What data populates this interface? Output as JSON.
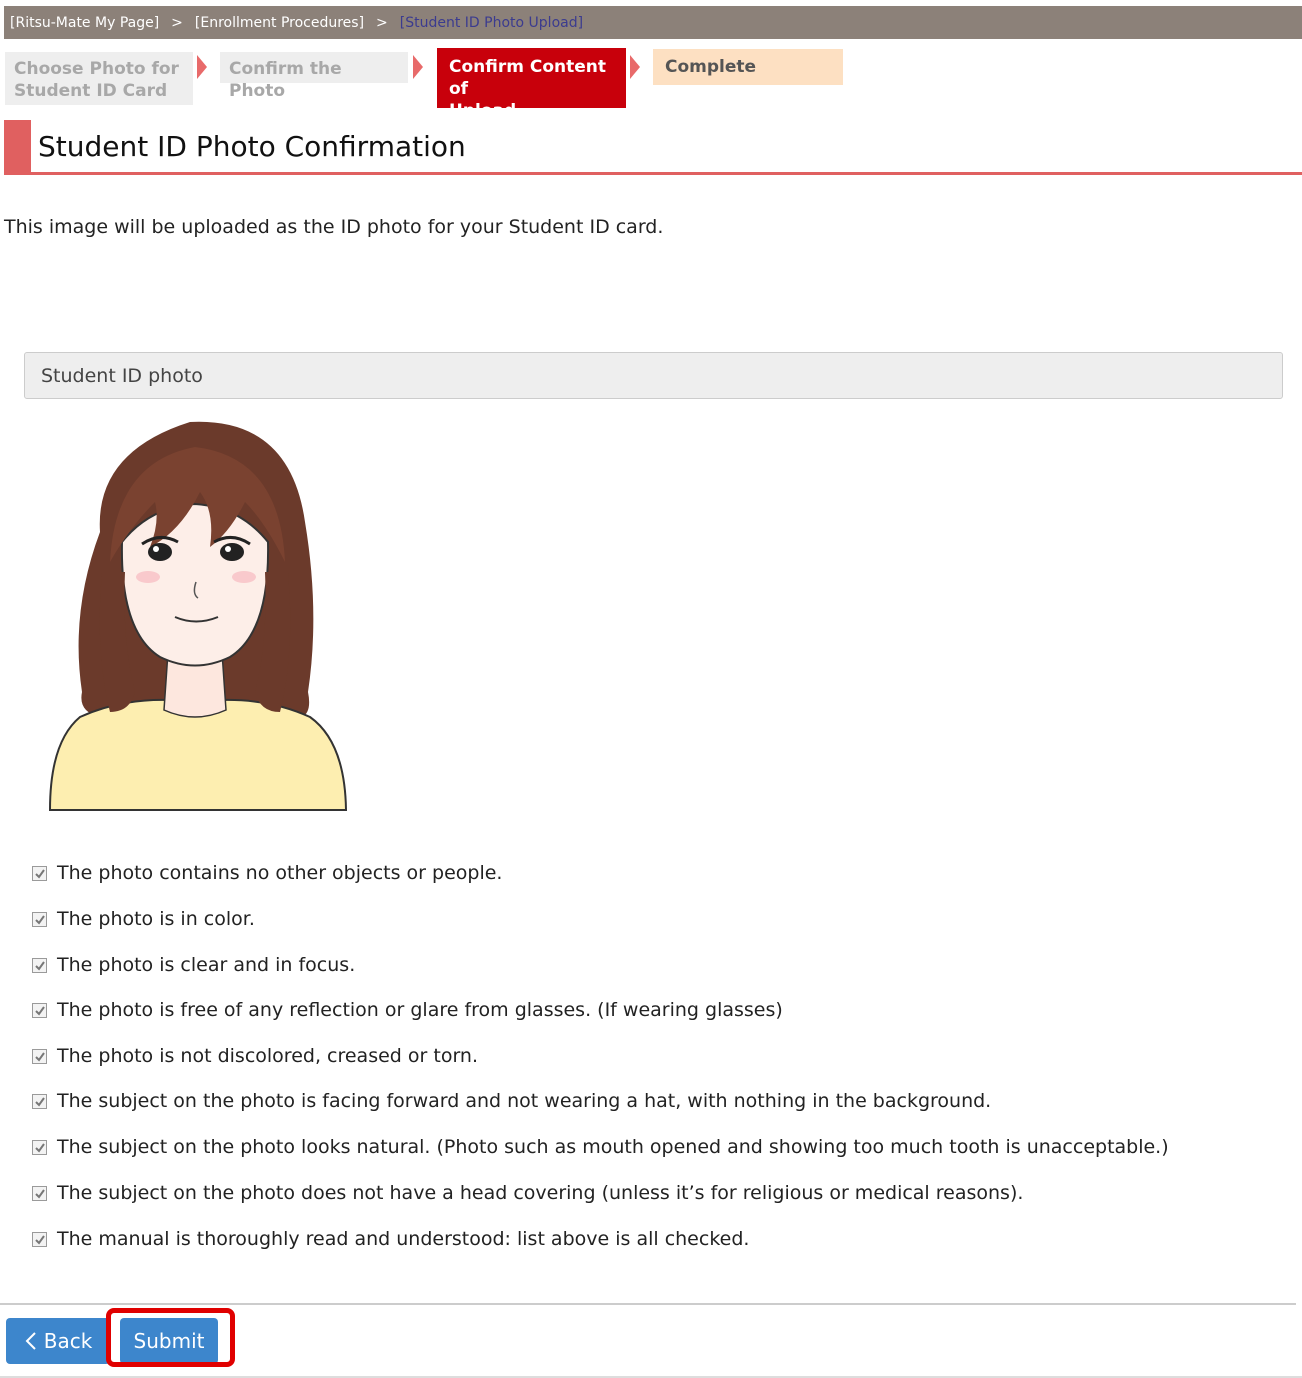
{
  "breadcrumb": {
    "items": [
      "[Ritsu-Mate My Page]",
      "[Enrollment Procedures]",
      "[Student ID Photo Upload]"
    ],
    "separator": ">"
  },
  "steps": [
    {
      "line1": "Choose Photo for",
      "line2": "Student ID Card",
      "state": "done"
    },
    {
      "line1": "Confirm the Photo",
      "line2": "",
      "state": "done"
    },
    {
      "line1": "Confirm Content of",
      "line2": "Upload",
      "state": "current"
    },
    {
      "line1": "Complete",
      "line2": "",
      "state": "upcoming"
    }
  ],
  "page_title": "Student ID Photo Confirmation",
  "intro_text": "This image will be uploaded as the ID photo for your Student ID card.",
  "photo_section": {
    "header": "Student ID photo"
  },
  "checklist": [
    {
      "label": "The photo contains no other objects or people.",
      "checked": true
    },
    {
      "label": "The photo is in color.",
      "checked": true
    },
    {
      "label": "The photo is clear and in focus.",
      "checked": true
    },
    {
      "label": "The photo is free of any reflection or glare from glasses. (If wearing glasses)",
      "checked": true
    },
    {
      "label": "The photo is not discolored, creased or torn.",
      "checked": true
    },
    {
      "label": "The subject on the photo is facing forward and not wearing a hat, with nothing in the background.",
      "checked": true
    },
    {
      "label": "The subject on the photo looks natural. (Photo such as mouth opened and showing too much tooth is unacceptable.)",
      "checked": true
    },
    {
      "label": "The subject on the photo does not have a head covering (unless it’s for religious or medical reasons).",
      "checked": true
    },
    {
      "label": "The manual is thoroughly read and understood: list above is all checked.",
      "checked": true
    }
  ],
  "buttons": {
    "back_label": "Back",
    "submit_label": "Submit"
  },
  "colors": {
    "breadcrumb_bg": "#8c8179",
    "step_current": "#c8000b",
    "step_done_bg": "#eeeeee",
    "step_upcoming_bg": "#fde0c2",
    "title_accent": "#e06060",
    "button": "#3d86cc",
    "highlight": "#e00000"
  }
}
